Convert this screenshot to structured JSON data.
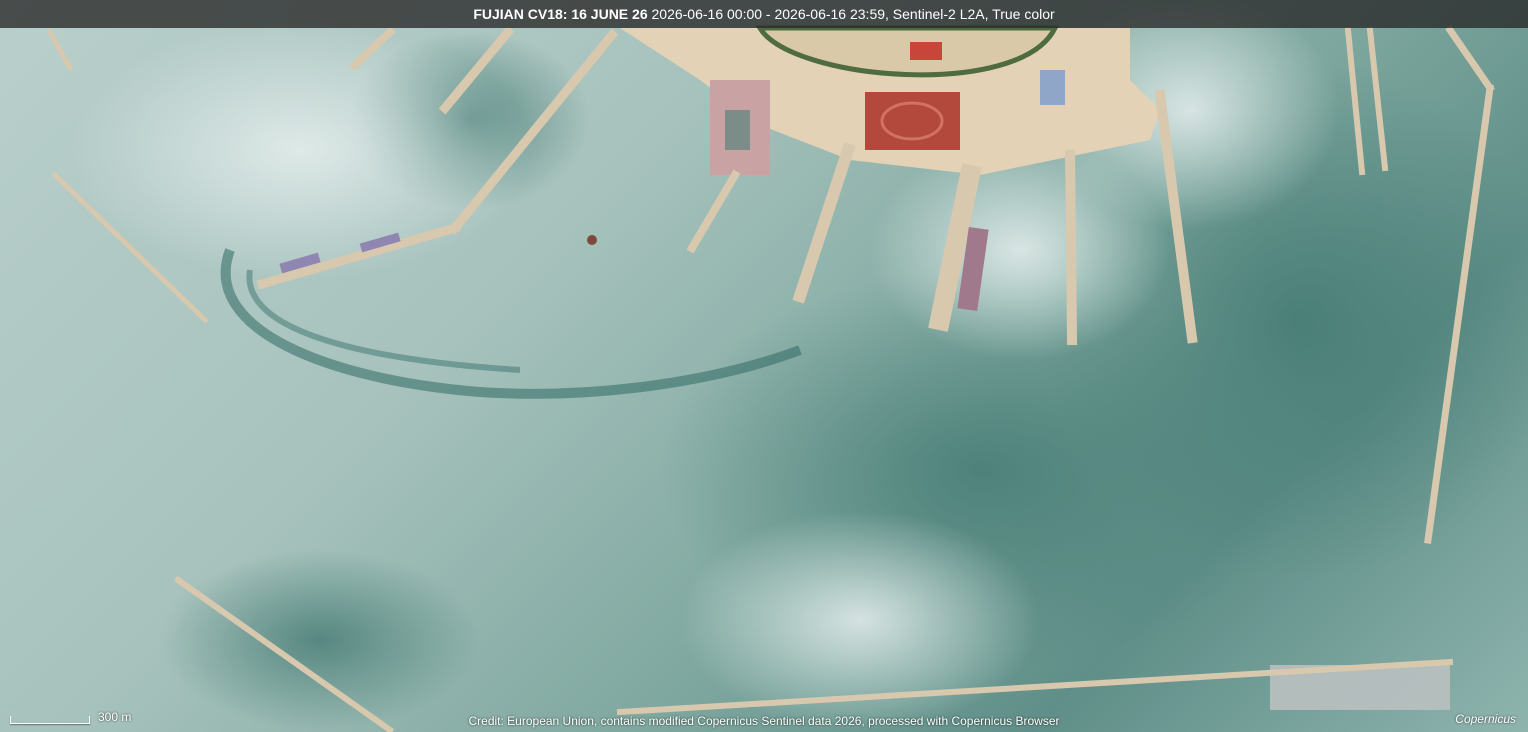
{
  "header": {
    "title_bold": "FUJIAN CV18: 16 JUNE 26",
    "title_rest": " 2026-06-16 00:00 - 2026-06-16 23:59, Sentinel-2 L2A, True color"
  },
  "scale": {
    "label": "300 m"
  },
  "credit": "Credit: European Union, contains modified Copernicus Sentinel data 2026, processed with Copernicus Browser",
  "logo": "Copernicus",
  "colors": {
    "water_light": "#b9cfcb",
    "water_dark": "#4f827b",
    "pier": "#d8c8ae",
    "land": "#e3d2b6",
    "track": "#c0392b"
  }
}
